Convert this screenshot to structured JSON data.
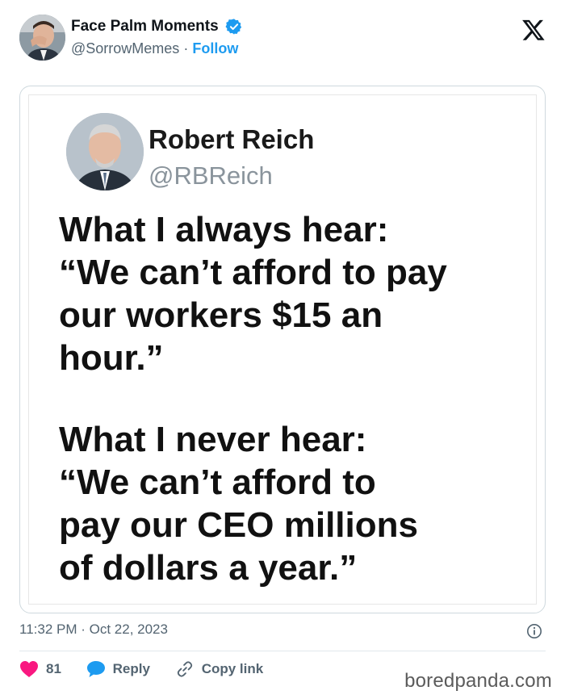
{
  "post": {
    "author_name": "Face Palm Moments",
    "handle": "@SorrowMemes",
    "separator": "·",
    "follow_label": "Follow",
    "timestamp": "11:32 PM · Oct 22, 2023"
  },
  "embedded": {
    "name": "Robert Reich",
    "handle": "@RBReich",
    "paragraph1": "What I always hear:\n“We can’t afford to pay\nour workers $15 an\nhour.”",
    "paragraph2": "What I never hear:\n“We can’t afford to\npay our CEO millions\nof dollars a year.”"
  },
  "actions": {
    "like_count": "81",
    "reply_label": "Reply",
    "copy_link_label": "Copy link"
  },
  "watermark": "boredpanda.com",
  "icons": {
    "verified": "verified-badge-icon",
    "x_logo": "x-logo-icon",
    "info": "info-icon",
    "heart": "heart-icon",
    "reply": "speech-bubble-icon",
    "link": "link-icon"
  },
  "colors": {
    "accent": "#1d9bf0",
    "like": "#f91880",
    "muted": "#536471"
  }
}
